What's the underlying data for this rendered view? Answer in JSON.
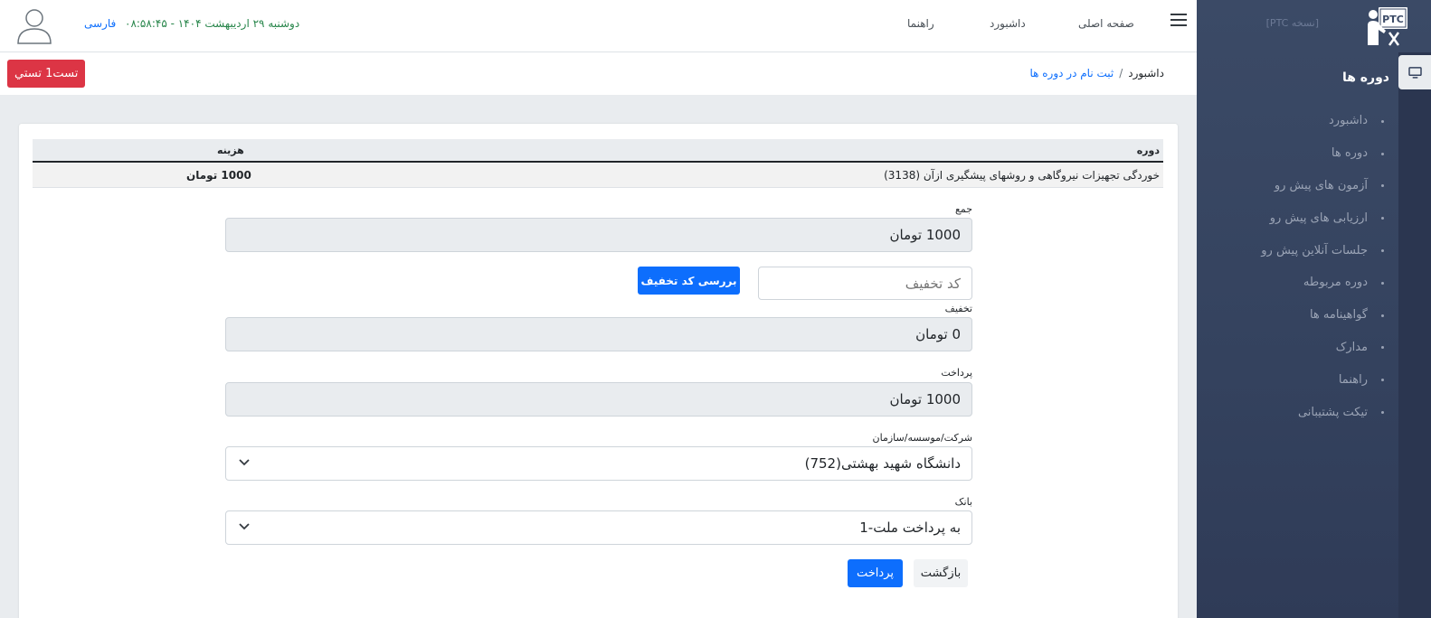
{
  "sidebar": {
    "version": "[PTC نسخه]",
    "logo_text": "PTC",
    "section_title": "دوره ها",
    "items": [
      {
        "label": "داشبورد"
      },
      {
        "label": "دوره ها"
      },
      {
        "label": "آزمون های پیش رو"
      },
      {
        "label": "ارزیابی های پیش رو"
      },
      {
        "label": "جلسات آنلاین پیش رو"
      },
      {
        "label": "دوره مربوطه"
      },
      {
        "label": "گواهینامه ها"
      },
      {
        "label": "مدارک"
      },
      {
        "label": "راهنما"
      },
      {
        "label": "تیکت پشتیبانی"
      }
    ]
  },
  "header": {
    "nav": {
      "home": "صفحه اصلی",
      "dashboard": "داشبورد",
      "help": "راهنما"
    },
    "datetime": "دوشنبه ۲۹ اردیبهشت ۱۴۰۴ - ۰۸:۵۸:۴۵",
    "language": "فارسی"
  },
  "breadcrumb": {
    "home": "داشبورد",
    "separator": "/",
    "current": "ثبت نام در دوره ها"
  },
  "user_badge": "تست1 تستي",
  "table": {
    "headers": {
      "course": "دوره",
      "cost": "هزینه"
    },
    "rows": [
      {
        "course": "خوردگی تجهیزات نیروگاهی و روشهای پیشگیری ازآن (3138)",
        "cost": "1000 تومان"
      }
    ]
  },
  "form": {
    "total_label": "جمع",
    "total_value": "1000 تومان",
    "discount_code_placeholder": "کد تخفیف",
    "check_discount_button": "بررسی کد تخفیف",
    "discount_label": "تخفیف",
    "discount_value": "0 تومان",
    "payment_label": "پرداخت",
    "payment_value": "1000 تومان",
    "organization_label": "شرکت/موسسه/سازمان",
    "organization_value": "دانشگاه شهید بهشتی(752)",
    "bank_label": "بانک",
    "bank_value": "به پرداخت ملت-1",
    "pay_button": "پرداخت",
    "back_button": "بازگشت"
  },
  "colors": {
    "sidebar_bg": "#34425e",
    "primary": "#0d6efd",
    "danger": "#dc3545",
    "datetime": "#28864b"
  }
}
